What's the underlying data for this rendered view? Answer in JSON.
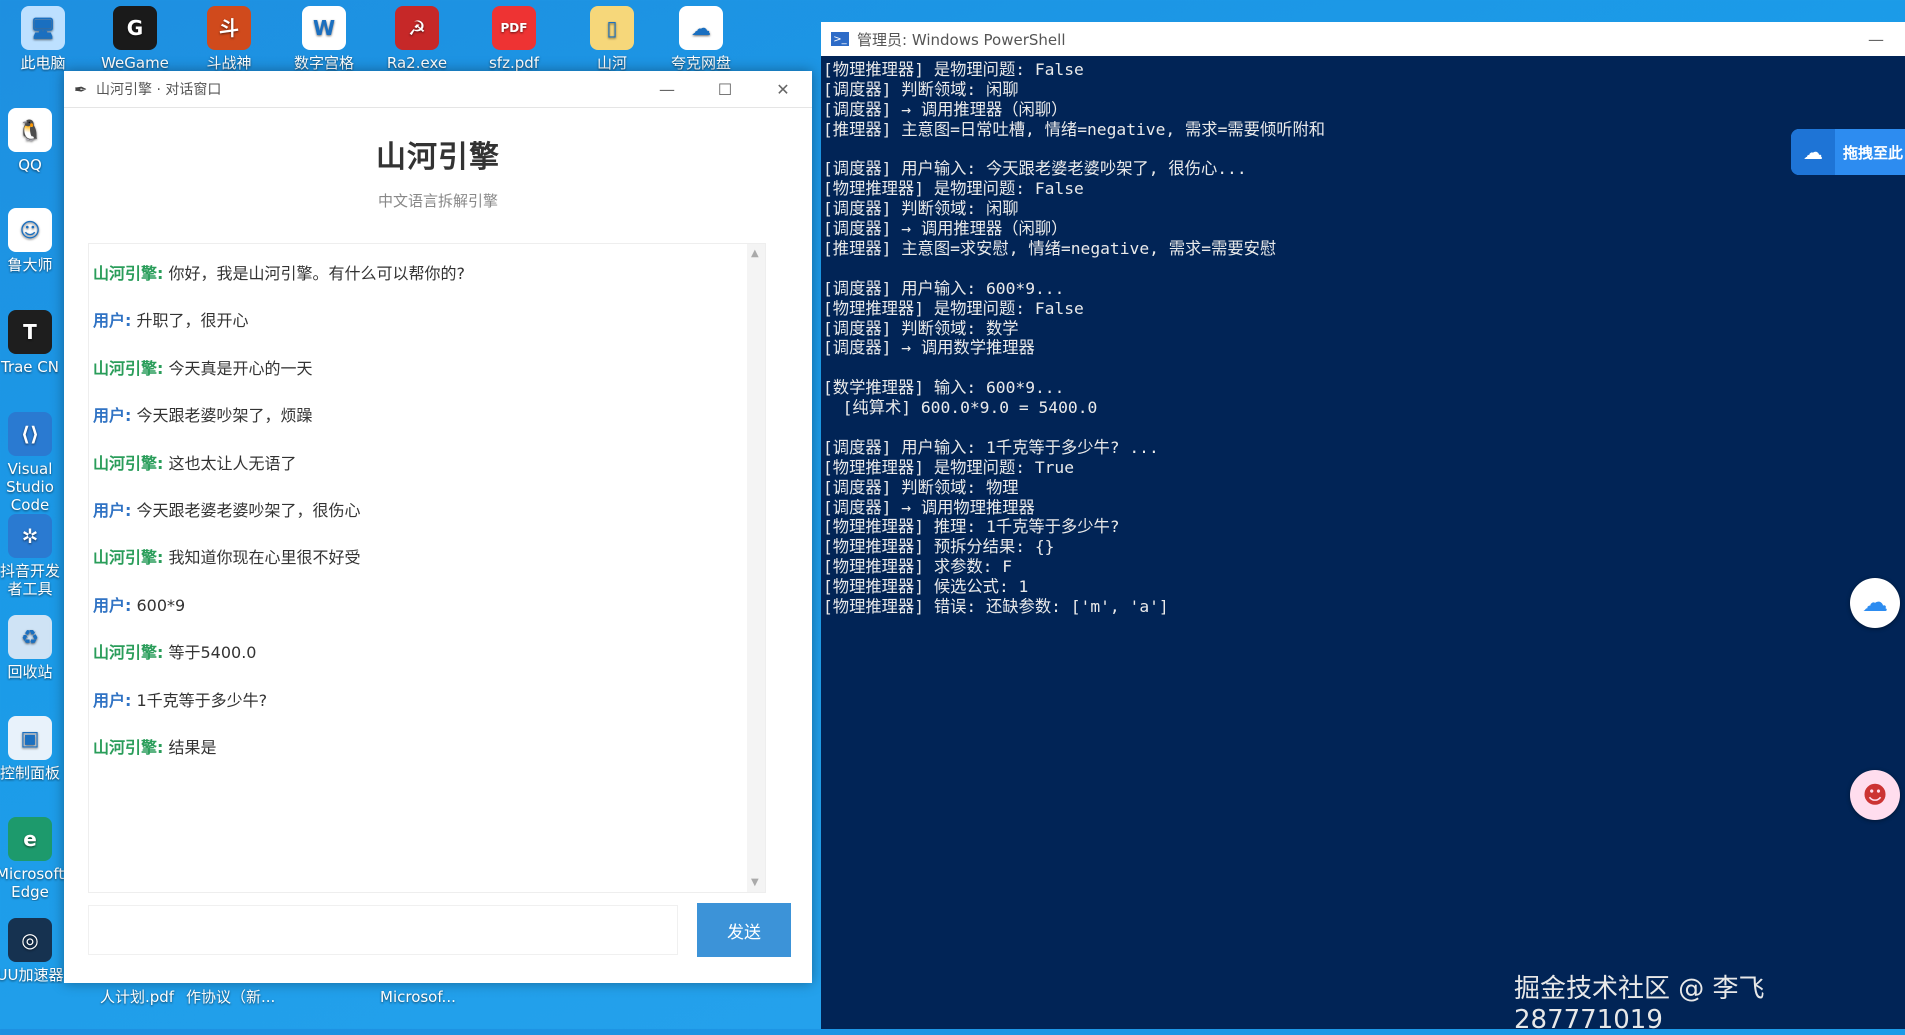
{
  "desktop": {
    "top_icons": [
      {
        "label": "此电脑",
        "icon": "computer-icon",
        "glyph": "🖥"
      },
      {
        "label": "WeGame",
        "icon": "wegame-icon",
        "glyph": "G"
      },
      {
        "label": "斗战神",
        "icon": "game-icon",
        "glyph": "斗"
      },
      {
        "label": "数字宫格",
        "icon": "word-doc-icon",
        "glyph": "W"
      },
      {
        "label": "Ra2.exe",
        "icon": "ra2-icon",
        "glyph": "☭"
      },
      {
        "label": "sfz.pdf",
        "icon": "pdf-icon",
        "glyph": "PDF"
      },
      {
        "label": "山河",
        "icon": "folder-icon",
        "glyph": "▯"
      },
      {
        "label": "夸克网盘",
        "icon": "quark-cloud-icon",
        "glyph": "☁"
      }
    ],
    "left_icons": [
      {
        "label": "QQ",
        "icon": "qq-icon",
        "glyph": "🐧"
      },
      {
        "label": "鲁大师",
        "icon": "ludashi-icon",
        "glyph": "☺"
      },
      {
        "label": "Trae CN",
        "icon": "trae-icon",
        "glyph": "T"
      },
      {
        "label": "Visual Studio Code",
        "icon": "vscode-icon",
        "glyph": "⟨⟩"
      },
      {
        "label": "抖音开发者工具",
        "icon": "douyin-dev-icon",
        "glyph": "✲"
      },
      {
        "label": "回收站",
        "icon": "recycle-bin-icon",
        "glyph": "♻"
      },
      {
        "label": "控制面板",
        "icon": "control-panel-icon",
        "glyph": "▣"
      },
      {
        "label": "Microsoft Edge",
        "icon": "edge-icon",
        "glyph": "e"
      },
      {
        "label": "UU加速器",
        "icon": "uu-icon",
        "glyph": "◎"
      }
    ],
    "bottom_labels": [
      "人计划.pdf",
      "作协议（新...",
      "Microsof..."
    ]
  },
  "chat": {
    "window_title": "山河引擎 · 对话窗口",
    "app_title": "山河引擎",
    "app_subtitle": "中文语言拆解引擎",
    "messages": [
      {
        "sender": "山河引擎:",
        "role": "bot",
        "text": "你好，我是山河引擎。有什么可以帮你的?"
      },
      {
        "sender": "用户:",
        "role": "user",
        "text": "升职了，很开心"
      },
      {
        "sender": "山河引擎:",
        "role": "bot",
        "text": "今天真是开心的一天"
      },
      {
        "sender": "用户:",
        "role": "user",
        "text": "今天跟老婆吵架了，烦躁"
      },
      {
        "sender": "山河引擎:",
        "role": "bot",
        "text": "这也太让人无语了"
      },
      {
        "sender": "用户:",
        "role": "user",
        "text": "今天跟老婆老婆吵架了，很伤心"
      },
      {
        "sender": "山河引擎:",
        "role": "bot",
        "text": "我知道你现在心里很不好受"
      },
      {
        "sender": "用户:",
        "role": "user",
        "text": "600*9"
      },
      {
        "sender": "山河引擎:",
        "role": "bot",
        "text": "等于5400.0"
      },
      {
        "sender": "用户:",
        "role": "user",
        "text": "1千克等于多少牛?"
      },
      {
        "sender": "山河引擎:",
        "role": "bot",
        "text": "结果是"
      }
    ],
    "input_value": "",
    "send_label": "发送",
    "minimize": "—",
    "maximize": "☐",
    "close": "✕"
  },
  "powershell": {
    "window_title": "管理员: Windows PowerShell",
    "lines": [
      "[物理推理器] 是物理问题: False",
      "[调度器] 判断领域: 闲聊",
      "[调度器] → 调用推理器（闲聊）",
      "[推理器] 主意图=日常吐槽, 情绪=negative, 需求=需要倾听附和",
      "",
      "[调度器] 用户输入: 今天跟老婆老婆吵架了, 很伤心...",
      "[物理推理器] 是物理问题: False",
      "[调度器] 判断领域: 闲聊",
      "[调度器] → 调用推理器（闲聊）",
      "[推理器] 主意图=求安慰, 情绪=negative, 需求=需要安慰",
      "",
      "[调度器] 用户输入: 600*9...",
      "[物理推理器] 是物理问题: False",
      "[调度器] 判断领域: 数学",
      "[调度器] → 调用数学推理器",
      "",
      "[数学推理器] 输入: 600*9...",
      "  [纯算术] 600.0*9.0 = 5400.0",
      "",
      "[调度器] 用户输入: 1千克等于多少牛? ...",
      "[物理推理器] 是物理问题: True",
      "[调度器] 判断领域: 物理",
      "[调度器] → 调用物理推理器",
      "[物理推理器] 推理: 1千克等于多少牛?",
      "[物理推理器] 预拆分结果: {}",
      "[物理推理器] 求参数: F",
      "[物理推理器] 候选公式: 1",
      "[物理推理器] 错误: 还缺参数: ['m', 'a']"
    ],
    "close": "—"
  },
  "widgets": {
    "baidu_upload_label": "拖拽至此",
    "watermark": "掘金技术社区 @ 李飞287771019"
  }
}
